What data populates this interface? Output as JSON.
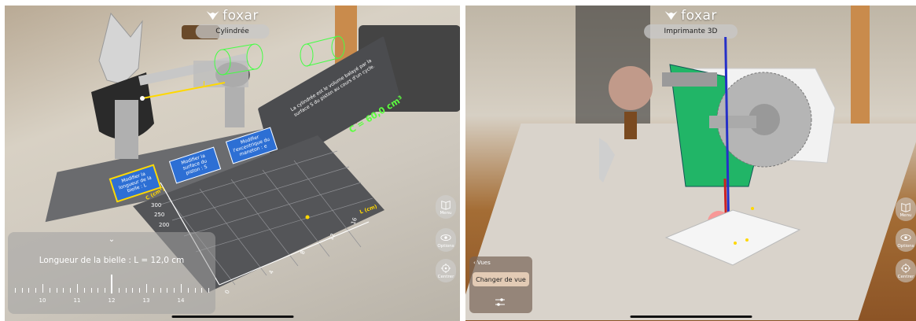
{
  "screens": [
    {
      "brand": "foxar",
      "title": "Cylindrée",
      "info_board": {
        "text": "La cylindrée est le volume balayé par la surface S du piston au cours d'un cycle.",
        "formula": "C = 60,0 cm³"
      },
      "link_label": "L",
      "buttons": [
        "Modifier la longueur de la bielle : L",
        "Modifier la surface du piston : S",
        "Modifier l'excentrique du maneton : e"
      ],
      "graph": {
        "y_label": "C (cm³)",
        "x_label": "L (cm)",
        "y_ticks": [
          "300",
          "250",
          "200"
        ],
        "x_ticks": [
          "0",
          "4",
          "8",
          "12",
          "16"
        ]
      },
      "param_panel": {
        "label": "Longueur de la bielle : L = 12,0 cm",
        "ruler_labels": [
          "10",
          "11",
          "12",
          "13",
          "14"
        ],
        "value": 12.0
      },
      "side_buttons": [
        "Menu",
        "Options",
        "Centrer"
      ]
    },
    {
      "brand": "foxar",
      "title": "Imprimante 3D",
      "panel": {
        "header": "Vues",
        "button": "Changer de vue"
      },
      "side_buttons": [
        "Menu",
        "Options",
        "Centrer"
      ]
    }
  ],
  "colors": {
    "accent_blue": "#2d6fd4",
    "highlight_yellow": "#ffd800",
    "formula_green": "#5cff40",
    "printer_green": "#21b567"
  }
}
